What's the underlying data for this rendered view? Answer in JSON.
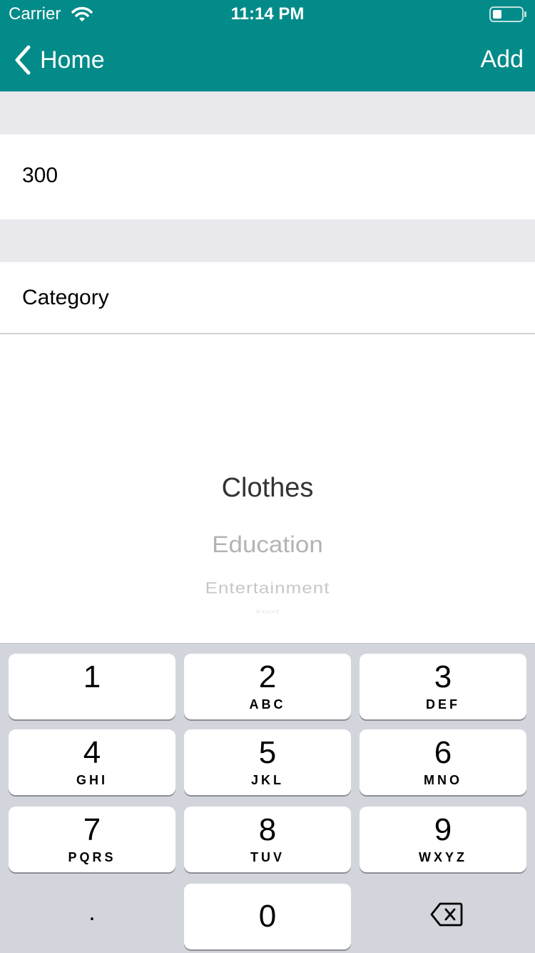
{
  "status_bar": {
    "carrier": "Carrier",
    "time": "11:14 PM"
  },
  "nav": {
    "back_label": "Home",
    "action_label": "Add"
  },
  "form": {
    "amount_value": "300",
    "category_label": "Category"
  },
  "picker": {
    "options": [
      "Clothes",
      "Education",
      "Entertainment",
      "Food"
    ],
    "selected": "Clothes"
  },
  "keypad": {
    "keys": [
      {
        "num": "1",
        "letters": ""
      },
      {
        "num": "2",
        "letters": "ABC"
      },
      {
        "num": "3",
        "letters": "DEF"
      },
      {
        "num": "4",
        "letters": "GHI"
      },
      {
        "num": "5",
        "letters": "JKL"
      },
      {
        "num": "6",
        "letters": "MNO"
      },
      {
        "num": "7",
        "letters": "PQRS"
      },
      {
        "num": "8",
        "letters": "TUV"
      },
      {
        "num": "9",
        "letters": "WXYZ"
      },
      {
        "num": "0",
        "letters": ""
      }
    ],
    "decimal": "."
  },
  "colors": {
    "accent": "#028b89",
    "group_bg": "#e8e8ed",
    "keyboard_bg": "#d2d5db"
  }
}
